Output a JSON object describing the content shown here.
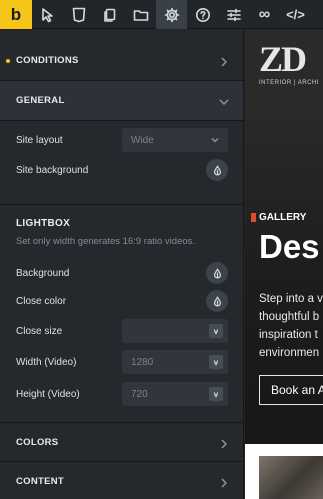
{
  "toolbar": {
    "logo": "b",
    "html5_glyph": "5",
    "infinity_glyph": "∞",
    "code_glyph": "</>",
    "icons": [
      "cursor-icon",
      "html5-icon",
      "pages-icon",
      "folder-icon",
      "gear-icon",
      "help-icon",
      "sliders-icon",
      "infinity-icon",
      "code-icon"
    ],
    "active": "gear-icon",
    "accent": "#f5c518"
  },
  "sections": {
    "conditions": "CONDITIONS",
    "general": "GENERAL",
    "colors": "COLORS",
    "content": "CONTENT"
  },
  "general": {
    "site_layout_label": "Site layout",
    "site_layout_value": "Wide",
    "site_background_label": "Site background"
  },
  "lightbox": {
    "title": "LIGHTBOX",
    "description": "Set only width generates 16:9 ratio videos.",
    "background_label": "Background",
    "close_color_label": "Close color",
    "close_size_label": "Close size",
    "width_label": "Width (Video)",
    "width_placeholder": "1280",
    "height_label": "Height (Video)",
    "height_placeholder": "720",
    "unit_glyph": "v"
  },
  "preview": {
    "logo": "ZD",
    "logo_sub": "INTERIOR | ARCHI",
    "gallery": "GALLERY",
    "heading": "Des",
    "lines": [
      "Step into a v",
      "thoughtful b",
      "inspiration t",
      "environmen"
    ],
    "button": "Book an A"
  }
}
